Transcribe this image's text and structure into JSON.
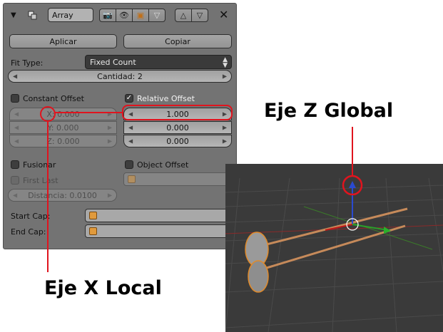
{
  "header": {
    "modifier_name": "Array",
    "close_icon": "x-icon"
  },
  "buttons": {
    "apply": "Aplicar",
    "copy": "Copiar"
  },
  "fit_type": {
    "label": "Fit Type:",
    "value": "Fixed Count"
  },
  "count": {
    "label": "Cantidad: 2"
  },
  "constant_offset": {
    "label": "Constant Offset",
    "checked": false,
    "x": "X: 0.000",
    "y": "Y: 0.000",
    "z": "Z: 0.000"
  },
  "relative_offset": {
    "label": "Relative Offset",
    "checked": true,
    "x": "1.000",
    "y": "0.000",
    "z": "0.000"
  },
  "merge": {
    "label": "Fusionar",
    "first_last": "First Last",
    "distance": "Distancia: 0.0100"
  },
  "object_offset": {
    "label": "Object Offset"
  },
  "caps": {
    "start": "Start Cap:",
    "end": "End Cap:"
  },
  "annotations": {
    "global_z": "Eje Z Global",
    "local_x": "Eje X Local",
    "highlight_color": "#e0141e"
  }
}
